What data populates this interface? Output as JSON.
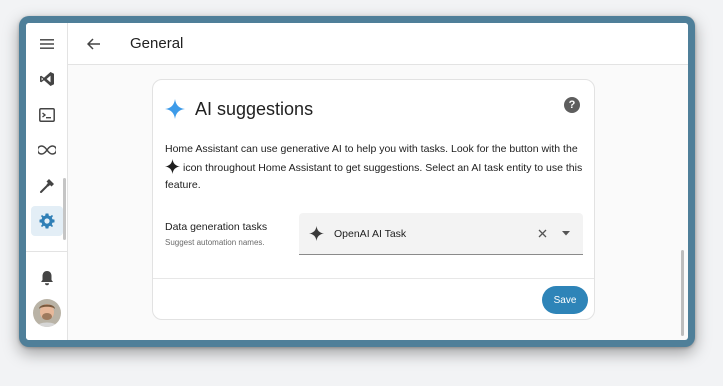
{
  "header": {
    "title": "General"
  },
  "sidebar": {
    "items": [
      {
        "icon": "menu-icon"
      },
      {
        "icon": "vscode-icon"
      },
      {
        "icon": "terminal-icon"
      },
      {
        "icon": "infinity-icon"
      },
      {
        "icon": "hammer-icon"
      },
      {
        "icon": "gear-icon",
        "active": true
      },
      {
        "icon": "bell-icon"
      },
      {
        "icon": "avatar"
      }
    ]
  },
  "card": {
    "title": "AI suggestions",
    "description_part1": "Home Assistant can use generative AI to help you with tasks. Look for the button with the",
    "description_part2": "icon throughout Home Assistant to get suggestions. Select an AI task entity to use this feature.",
    "field_label": "Data generation tasks",
    "field_sublabel": "Suggest automation names.",
    "select_value": "OpenAI AI Task",
    "save_label": "Save"
  },
  "colors": {
    "accent": "#2e84b8",
    "sparkle": "#3d9be9",
    "frame": "#4f7f99"
  }
}
